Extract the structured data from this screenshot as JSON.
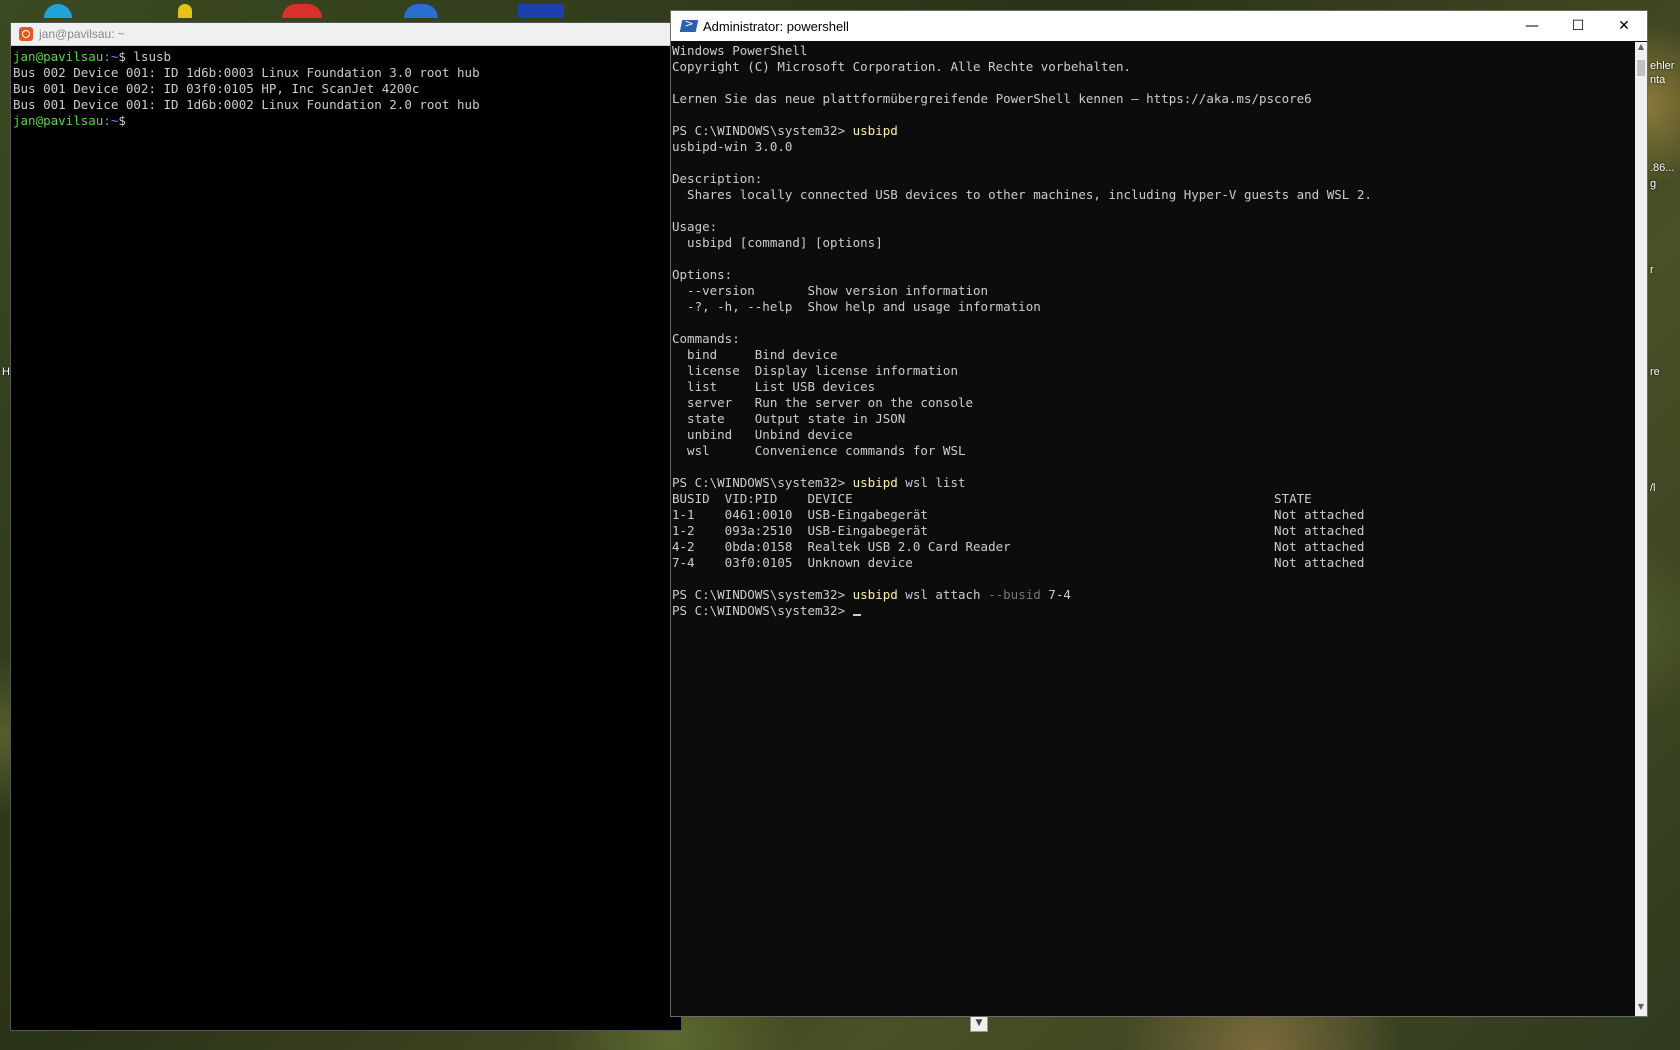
{
  "desktop": {
    "edge_labels": [
      "ehler",
      "nta",
      ".86...",
      "g",
      "r",
      "re",
      "/l",
      "H"
    ]
  },
  "ubuntu_terminal": {
    "title": "jan@pavilsau: ~",
    "prompt_user": "jan@pavilsau",
    "prompt_path": ":~",
    "prompt_symbol": "$",
    "command": " lsusb",
    "output": [
      "Bus 002 Device 001: ID 1d6b:0003 Linux Foundation 3.0 root hub",
      "Bus 001 Device 002: ID 03f0:0105 HP, Inc ScanJet 4200c",
      "Bus 001 Device 001: ID 1d6b:0002 Linux Foundation 2.0 root hub"
    ]
  },
  "powershell": {
    "title": "Administrator: powershell",
    "controls": {
      "minimize": "—",
      "maximize": "☐",
      "close": "✕"
    },
    "header_lines": [
      "Windows PowerShell",
      "Copyright (C) Microsoft Corporation. Alle Rechte vorbehalten.",
      "",
      "Lernen Sie das neue plattformübergreifende PowerShell kennen – https://aka.ms/pscore6",
      ""
    ],
    "prompt": "PS C:\\WINDOWS\\system32> ",
    "cmd1": "usbipd",
    "help_lines": [
      "usbipd-win 3.0.0",
      "",
      "Description:",
      "  Shares locally connected USB devices to other machines, including Hyper-V guests and WSL 2.",
      "",
      "Usage:",
      "  usbipd [command] [options]",
      "",
      "Options:",
      "  --version       Show version information",
      "  -?, -h, --help  Show help and usage information",
      "",
      "Commands:",
      "  bind     Bind device",
      "  license  Display license information",
      "  list     List USB devices",
      "  server   Run the server on the console",
      "  state    Output state in JSON",
      "  unbind   Unbind device",
      "  wsl      Convenience commands for WSL",
      ""
    ],
    "cmd2_exe": "usbipd",
    "cmd2_args": " wsl list",
    "list_lines": [
      "BUSID  VID:PID    DEVICE                                                        STATE",
      "1-1    0461:0010  USB-Eingabegerät                                              Not attached",
      "1-2    093a:2510  USB-Eingabegerät                                              Not attached",
      "4-2    0bda:0158  Realtek USB 2.0 Card Reader                                   Not attached",
      "7-4    03f0:0105  Unknown device                                                Not attached",
      ""
    ],
    "cmd3_exe": "usbipd",
    "cmd3_args": " wsl attach ",
    "cmd3_flag": "--busid",
    "cmd3_value": " 7-4"
  }
}
